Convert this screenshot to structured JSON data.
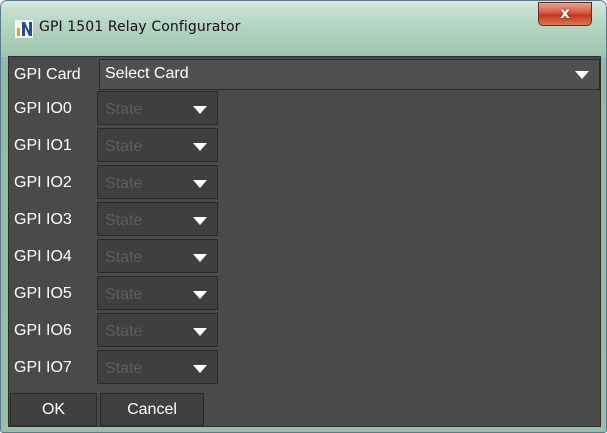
{
  "window": {
    "title": "GPI 1501 Relay Configurator",
    "close_glyph": "x",
    "app_icon": "n-logo-icon"
  },
  "card": {
    "label": "GPI Card",
    "selected": "Select Card"
  },
  "io_rows": [
    {
      "label": "GPI IO0",
      "state": "State"
    },
    {
      "label": "GPI IO1",
      "state": "State"
    },
    {
      "label": "GPI IO2",
      "state": "State"
    },
    {
      "label": "GPI IO3",
      "state": "State"
    },
    {
      "label": "GPI IO4",
      "state": "State"
    },
    {
      "label": "GPI IO5",
      "state": "State"
    },
    {
      "label": "GPI IO6",
      "state": "State"
    },
    {
      "label": "GPI IO7",
      "state": "State"
    }
  ],
  "buttons": {
    "ok": "OK",
    "cancel": "Cancel"
  },
  "colors": {
    "panel_bg": "#4a4a4a",
    "control_bg": "#3f3f3f",
    "disabled_text": "#5d5d5d",
    "close_button": "#c0391f"
  }
}
